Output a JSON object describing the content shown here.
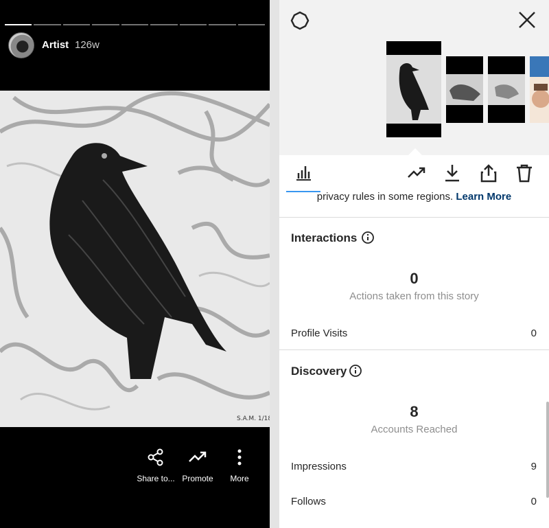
{
  "story": {
    "username": "Artist",
    "time_ago": "126w",
    "segments": 9
  },
  "actions": {
    "share_label": "Share to...",
    "promote_label": "Promote",
    "more_label": "More"
  },
  "insights": {
    "privacy_text": "privacy rules in some regions.",
    "learn_more": "Learn More",
    "interactions": {
      "title": "Interactions",
      "total": "0",
      "total_label": "Actions taken from this story",
      "rows": [
        {
          "label": "Profile Visits",
          "value": "0"
        }
      ]
    },
    "discovery": {
      "title": "Discovery",
      "total": "8",
      "total_label": "Accounts Reached",
      "rows": [
        {
          "label": "Impressions",
          "value": "9"
        },
        {
          "label": "Follows",
          "value": "0"
        }
      ]
    }
  },
  "colors": {
    "accent": "#3897f0",
    "link": "#00376b"
  }
}
